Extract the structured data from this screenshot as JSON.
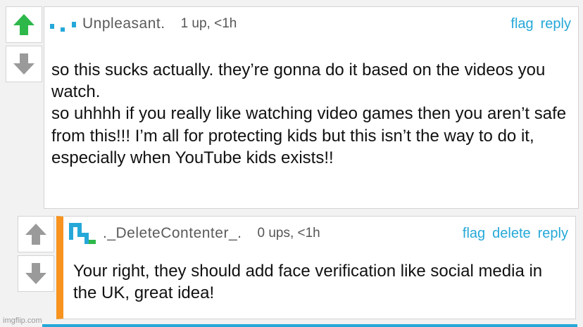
{
  "comments": [
    {
      "username": "Unpleasant.",
      "meta": "1 up, <1h",
      "actions": [
        "flag",
        "reply"
      ],
      "body": [
        "so this sucks actually. they’re gonna do it based on the videos you watch.",
        "so uhhhh if you really like watching video games then you aren’t safe from this!!! I’m all for protecting kids but this isn’t the way to do it, especially when YouTube kids exists!!"
      ],
      "upvote_state": "active",
      "avatar_color": "#25a8d8"
    },
    {
      "username": "._DeleteContenter_.",
      "meta": "0 ups, <1h",
      "actions": [
        "flag",
        "delete",
        "reply"
      ],
      "body": [
        "Your right, they should add face verification like social media in the UK, great idea!"
      ],
      "upvote_state": "inactive",
      "avatar_color": "#25a8d8",
      "avatar_accent": "#2eb84a",
      "highlight_color": "#f7931e"
    }
  ],
  "icons": {
    "upvote": "arrow-up-icon",
    "downvote": "arrow-down-icon"
  },
  "colors": {
    "link": "#25a8d8",
    "upvote_active": "#2eb84a",
    "vote_inactive": "#9a9a9a"
  },
  "watermark": "imgflip.com"
}
